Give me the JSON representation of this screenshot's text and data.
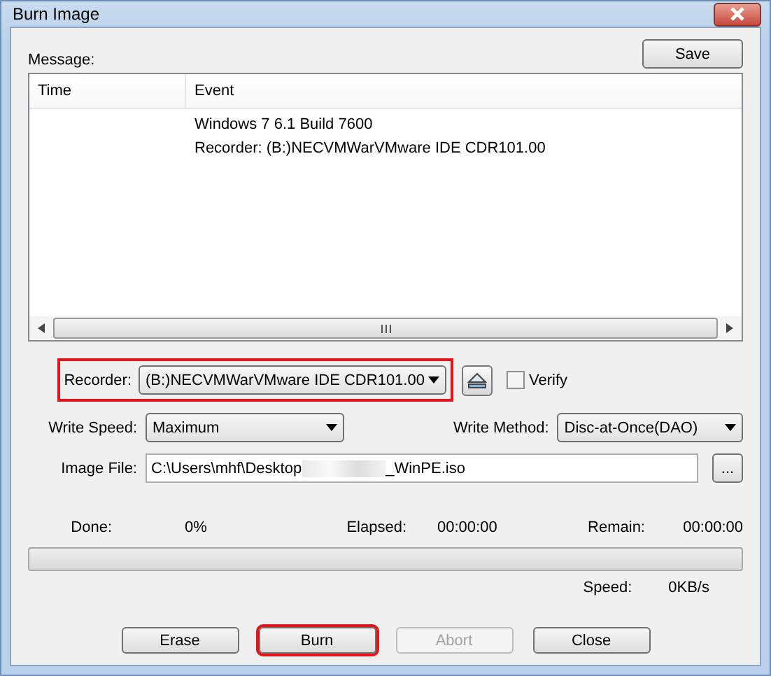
{
  "window": {
    "title": "Burn Image"
  },
  "message": {
    "label": "Message:",
    "save_button": "Save",
    "columns": [
      "Time",
      "Event"
    ],
    "rows": [
      {
        "time": "",
        "event": "Windows 7 6.1 Build 7600"
      },
      {
        "time": "",
        "event": "Recorder: (B:)NECVMWarVMware IDE CDR101.00"
      }
    ]
  },
  "recorder": {
    "label": "Recorder:",
    "value": "(B:)NECVMWarVMware IDE CDR101.00",
    "highlighted": true
  },
  "verify": {
    "label": "Verify",
    "checked": false
  },
  "write_speed": {
    "label": "Write Speed:",
    "value": "Maximum"
  },
  "write_method": {
    "label": "Write Method:",
    "value": "Disc-at-Once(DAO)"
  },
  "image_file": {
    "label": "Image File:",
    "value_start": "C:\\Users\\mhf\\Desktop",
    "value_end": "_WinPE.iso",
    "browse": "..."
  },
  "progress": {
    "done_label": "Done:",
    "done": "0%",
    "elapsed_label": "Elapsed:",
    "elapsed": "00:00:00",
    "remain_label": "Remain:",
    "remain": "00:00:00",
    "speed_label": "Speed:",
    "speed": "0KB/s"
  },
  "buttons": [
    {
      "label": "Erase",
      "disabled": false,
      "highlighted": false
    },
    {
      "label": "Burn",
      "disabled": false,
      "highlighted": true
    },
    {
      "label": "Abort",
      "disabled": true,
      "highlighted": false
    },
    {
      "label": "Close",
      "disabled": false,
      "highlighted": false
    }
  ]
}
